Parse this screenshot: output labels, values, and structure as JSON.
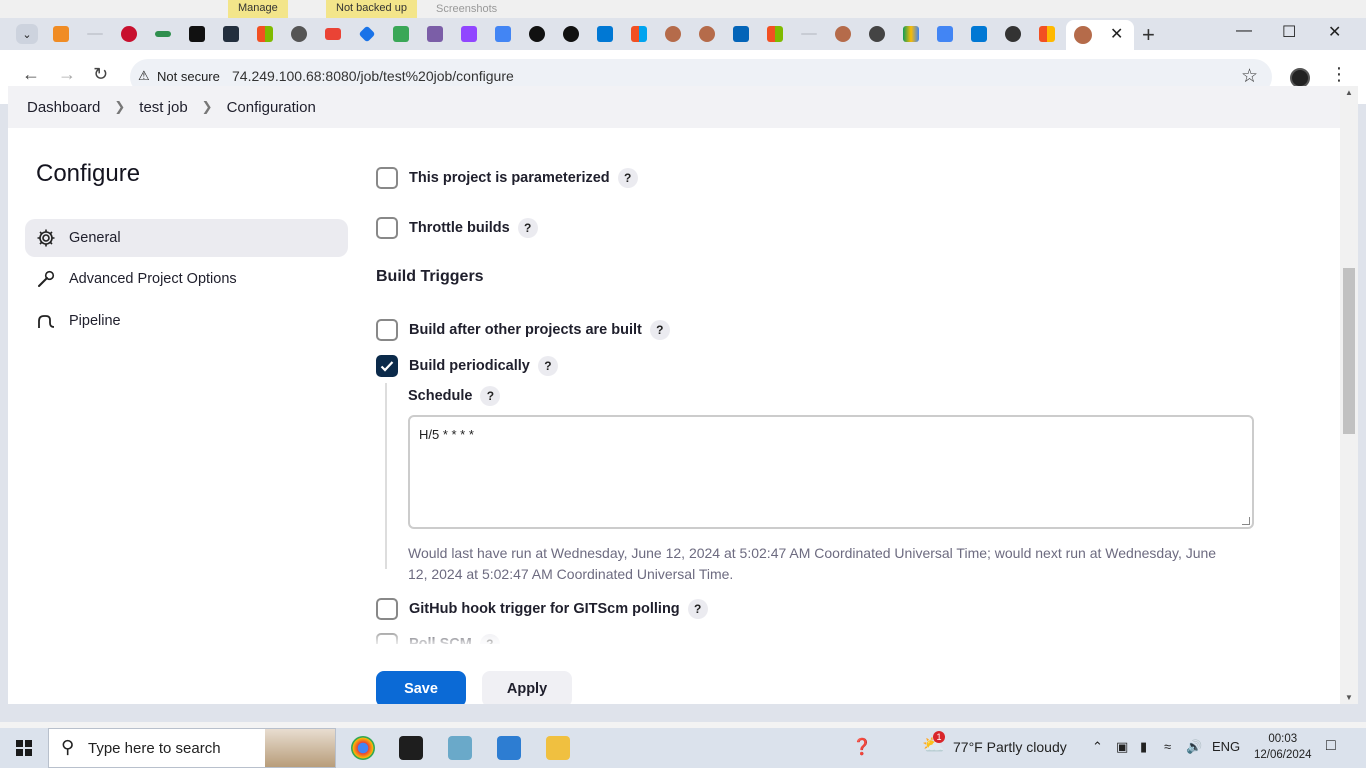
{
  "background_window": {
    "items": [
      "Manage",
      "Not backed up",
      "Screenshots"
    ]
  },
  "browser": {
    "security_label": "Not secure",
    "url": "74.249.100.68:8080/job/test%20job/configure"
  },
  "breadcrumb": {
    "items": [
      "Dashboard",
      "test job",
      "Configuration"
    ]
  },
  "sidebar": {
    "title": "Configure",
    "items": [
      {
        "label": "General",
        "icon": "gear-icon",
        "active": true
      },
      {
        "label": "Advanced Project Options",
        "icon": "wrench-icon",
        "active": false
      },
      {
        "label": "Pipeline",
        "icon": "pipeline-icon",
        "active": false
      }
    ]
  },
  "general": {
    "parameterized": {
      "label": "This project is parameterized",
      "checked": false
    },
    "throttle": {
      "label": "Throttle builds",
      "checked": false
    }
  },
  "build_triggers": {
    "title": "Build Triggers",
    "after_other": {
      "label": "Build after other projects are built",
      "checked": false
    },
    "periodically": {
      "label": "Build periodically",
      "checked": true
    },
    "schedule_label": "Schedule",
    "schedule_value": "H/5 * * * *",
    "schedule_info": "Would last have run at Wednesday, June 12, 2024 at 5:02:47 AM Coordinated Universal Time; would next run at Wednesday, June 12, 2024 at 5:02:47 AM Coordinated Universal Time.",
    "github_hook": {
      "label": "GitHub hook trigger for GITScm polling",
      "checked": false
    },
    "poll_scm": {
      "label": "Poll SCM",
      "checked": false
    }
  },
  "help_glyph": "?",
  "actions": {
    "save": "Save",
    "apply": "Apply"
  },
  "taskbar": {
    "search_placeholder": "Type here to search",
    "weather": "77°F  Partly cloudy",
    "language": "ENG",
    "time": "00:03",
    "date": "12/06/2024",
    "weather_badge": "1"
  },
  "colors": {
    "primary_button": "#0b6ad6",
    "checkbox_checked": "#0b2a4a",
    "breadcrumb_bg": "#f2f2f5"
  }
}
